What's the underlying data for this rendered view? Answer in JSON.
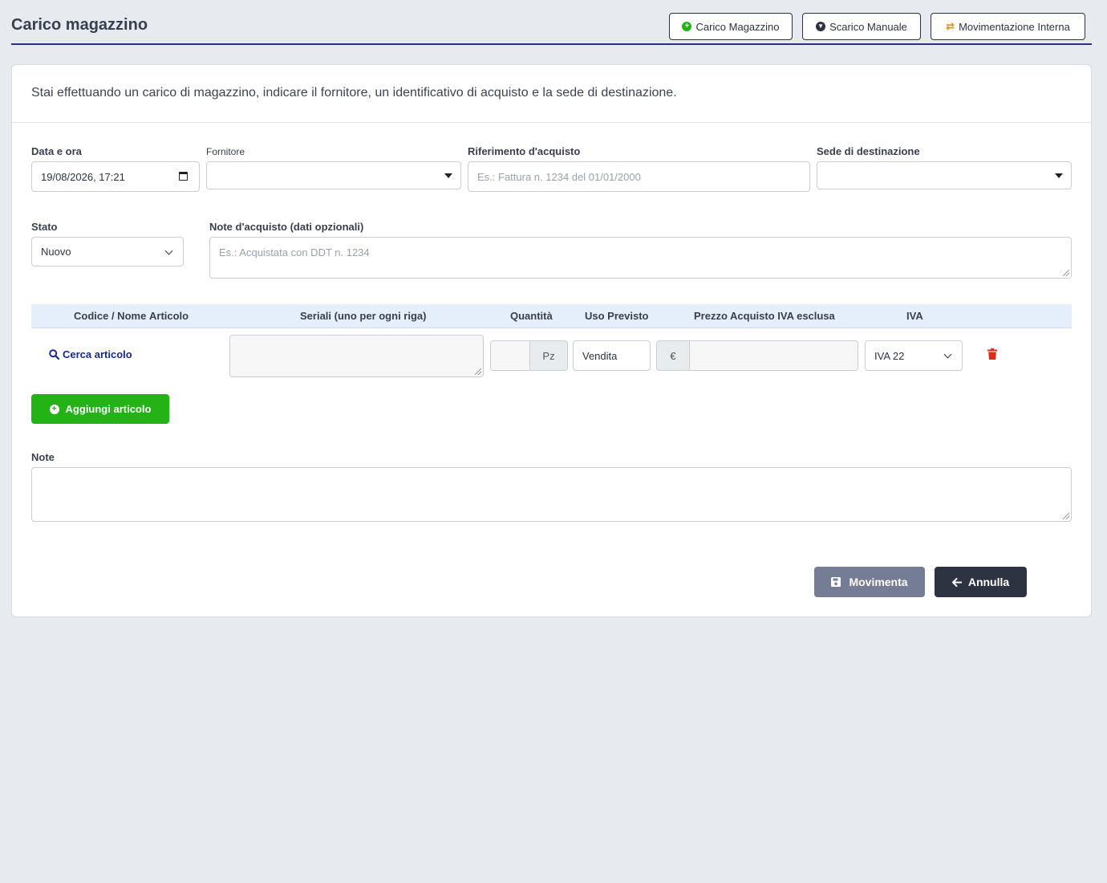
{
  "header": {
    "title": "Carico magazzino",
    "buttons": {
      "carico": "Carico Magazzino",
      "scarico": "Scarico Manuale",
      "movimentazione": "Movimentazione Interna"
    }
  },
  "intro": "Stai effettuando un carico di magazzino, indicare il fornitore, un identificativo di acquisto e la sede di destinazione.",
  "form": {
    "data_ora": {
      "label": "Data e ora",
      "value": "19/08/2026, 17:21"
    },
    "fornitore": {
      "label": "Fornitore",
      "value": ""
    },
    "riferimento": {
      "label": "Riferimento d'acquisto",
      "placeholder": "Es.: Fattura n. 1234 del 01/01/2000"
    },
    "sede": {
      "label": "Sede di destinazione",
      "value": ""
    },
    "stato": {
      "label": "Stato",
      "value": "Nuovo"
    },
    "note_acquisto": {
      "label": "Note d'acquisto (dati opzionali)",
      "placeholder": "Es.: Acquistata con DDT n. 1234"
    }
  },
  "table": {
    "headers": {
      "codice": "Codice / Nome",
      "articolo": "Articolo",
      "seriali": "Seriali (uno per ogni riga)",
      "quantita": "Quantità",
      "uso": "Uso Previsto",
      "prezzo": "Prezzo Acquisto IVA esclusa",
      "iva": "IVA"
    },
    "row": {
      "search_link": "Cerca articolo",
      "unit": "Pz",
      "uso": "Vendita",
      "currency": "€",
      "iva": "IVA 22"
    }
  },
  "add_button": "Aggiungi articolo",
  "note": {
    "label": "Note"
  },
  "actions": {
    "movimenta": "Movimenta",
    "annulla": "Annulla"
  },
  "colors": {
    "accent": "#2b2f86",
    "green": "#23b317",
    "danger": "#e02a1c",
    "link": "#1a2a8a"
  }
}
